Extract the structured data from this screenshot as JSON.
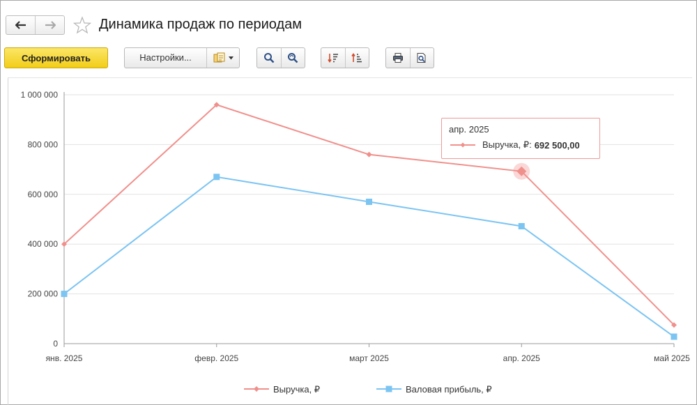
{
  "header": {
    "title": "Динамика продаж по периодам"
  },
  "toolbar": {
    "generate_label": "Сформировать",
    "settings_label": "Настройки..."
  },
  "colors": {
    "revenue": "#f0908c",
    "profit": "#7cc4f2",
    "primary_button": "#f2cd18"
  },
  "icons": [
    "back-arrow-icon",
    "forward-arrow-icon",
    "favorite-star-icon",
    "report-variant-icon",
    "dropdown-arrow-icon",
    "search-icon",
    "search-refresh-icon",
    "sort-descending-icon",
    "sort-ascending-icon",
    "print-icon",
    "print-preview-icon"
  ],
  "tooltip": {
    "period": "апр. 2025",
    "series": "Выручка, ₽:",
    "value": "692 500,00"
  },
  "chart_data": {
    "type": "line",
    "categories": [
      "янв. 2025",
      "февр. 2025",
      "март 2025",
      "апр. 2025",
      "май 2025"
    ],
    "series": [
      {
        "name": "Выручка, ₽",
        "values": [
          400000,
          960000,
          760000,
          692500,
          75000
        ],
        "marker": "diamond",
        "color": "#f0908c"
      },
      {
        "name": "Валовая прибыль, ₽",
        "values": [
          200000,
          670000,
          570000,
          472000,
          28000
        ],
        "marker": "square",
        "color": "#7cc4f2"
      }
    ],
    "yticks": [
      "0",
      "200 000",
      "400 000",
      "600 000",
      "800 000",
      "1 000 000"
    ],
    "ylim": [
      0,
      1000000
    ],
    "grid": true,
    "legend": "bottom",
    "highlight": {
      "series": 0,
      "index": 3
    }
  }
}
